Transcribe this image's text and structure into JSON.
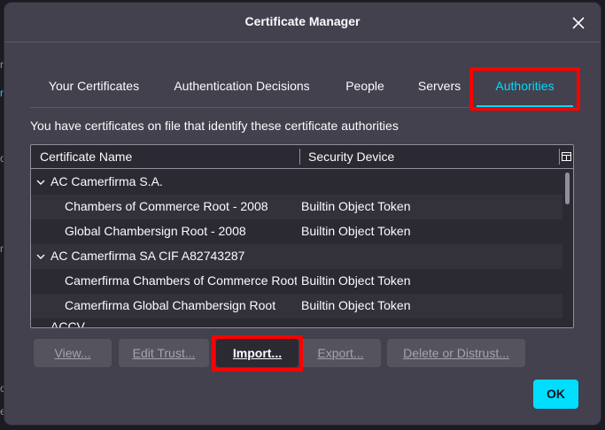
{
  "dialog": {
    "title": "Certificate Manager",
    "close_icon": "close-icon"
  },
  "tabs": [
    {
      "label": "Your Certificates",
      "selected": false
    },
    {
      "label": "Authentication Decisions",
      "selected": false
    },
    {
      "label": "People",
      "selected": false
    },
    {
      "label": "Servers",
      "selected": false
    },
    {
      "label": "Authorities",
      "selected": true
    }
  ],
  "description": "You have certificates on file that identify these certificate authorities",
  "tree": {
    "columns": {
      "name": "Certificate Name",
      "device": "Security Device",
      "picker_icon": "column-picker-icon"
    },
    "groups": [
      {
        "name": "AC Camerfirma S.A.",
        "expanded": true,
        "items": [
          {
            "name": "Chambers of Commerce Root - 2008",
            "device": "Builtin Object Token"
          },
          {
            "name": "Global Chambersign Root - 2008",
            "device": "Builtin Object Token"
          }
        ]
      },
      {
        "name": "AC Camerfirma SA CIF A82743287",
        "expanded": true,
        "items": [
          {
            "name": "Camerfirma Chambers of Commerce Root",
            "device": "Builtin Object Token"
          },
          {
            "name": "Camerfirma Global Chambersign Root",
            "device": "Builtin Object Token"
          }
        ]
      },
      {
        "name": "ACCV",
        "expanded": true,
        "items": []
      }
    ]
  },
  "buttons": {
    "view": {
      "accesskey": "V",
      "rest": "iew..."
    },
    "edit_trust": {
      "accesskey": "E",
      "rest": "dit Trust..."
    },
    "import": {
      "accesskey": "I",
      "pre": "",
      "rest": "mport..."
    },
    "export": {
      "accesskey": "x",
      "pre": "E",
      "rest": "port..."
    },
    "delete": {
      "accesskey": "D",
      "rest": "elete or Distrust..."
    },
    "ok": "OK"
  },
  "colors": {
    "accent": "#00ddff",
    "highlight": "#ff0000",
    "dialog_bg": "#42414d"
  }
}
